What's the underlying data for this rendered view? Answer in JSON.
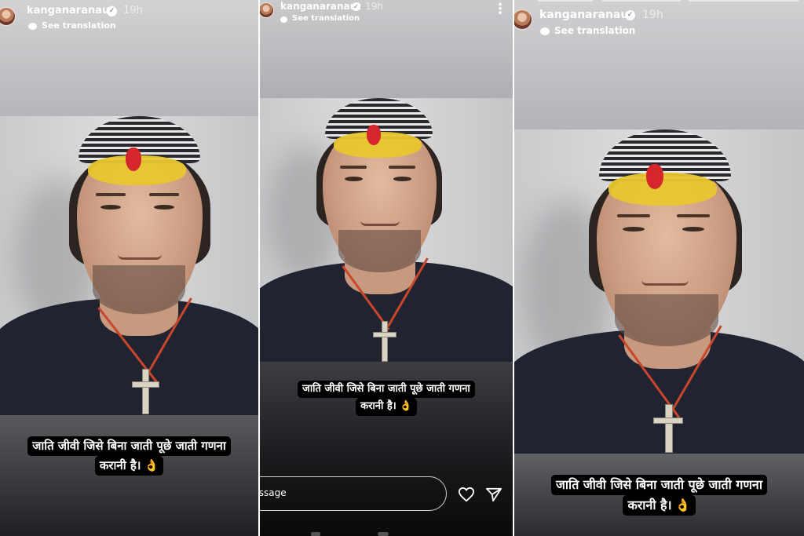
{
  "story": {
    "username": "kanganaranaut",
    "verified_icon": "verified-badge-icon",
    "time": "19h",
    "translate_label": "See translation",
    "translate_icon": "speech-bubble-icon",
    "caption_line1": "जाति जीवी जिसे बिना जाती पूछे जाती गणना",
    "caption_line2": "करानी है।",
    "caption_emoji": "👌"
  },
  "reply_bar": {
    "placeholder": "Message",
    "like_icon": "heart-icon",
    "share_icon": "send-icon",
    "more_icon": "more-vertical-icon"
  },
  "colors": {
    "caption_bg": "#000000",
    "caption_text": "#ffffff",
    "shirt": "#212430",
    "tilak_yellow": "#e8c62f",
    "tilak_red": "#d4262c"
  }
}
